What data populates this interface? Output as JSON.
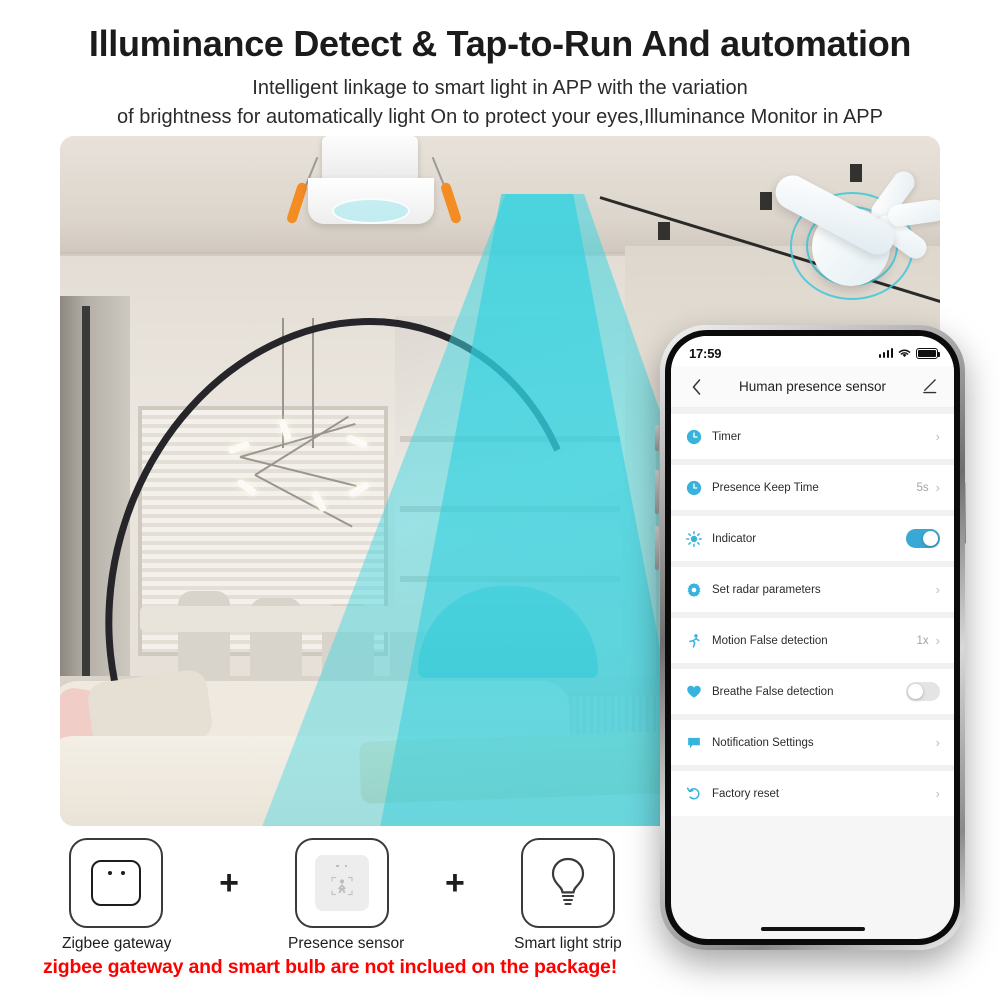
{
  "header": {
    "title": "Illuminance Detect & Tap-to-Run And automation",
    "subtitle_line1": "Intelligent linkage to smart light in APP with the variation",
    "subtitle_line2": "of brightness for automatically light On to protect your eyes,Illuminance Monitor in APP"
  },
  "phone": {
    "status": {
      "time": "17:59",
      "signal_icon": "cellular-signal-icon",
      "wifi_icon": "wifi-icon",
      "battery_icon": "battery-full-icon"
    },
    "nav": {
      "back_icon": "back-chevron-icon",
      "title": "Human presence sensor",
      "edit_icon": "edit-pencil-icon"
    },
    "rows": [
      {
        "icon": "clock-timer-icon",
        "label": "Timer",
        "value": "",
        "control": "chevron"
      },
      {
        "icon": "clock-icon",
        "label": "Presence Keep Time",
        "value": "5s",
        "control": "chevron"
      },
      {
        "icon": "brightness-sun-icon",
        "label": "Indicator",
        "value": "",
        "control": "toggle-on"
      },
      {
        "icon": "gear-icon",
        "label": "Set radar parameters",
        "value": "",
        "control": "chevron"
      },
      {
        "icon": "running-person-icon",
        "label": "Motion False detection",
        "value": "1x",
        "control": "chevron"
      },
      {
        "icon": "heart-icon",
        "label": "Breathe False detection",
        "value": "",
        "control": "toggle-off"
      },
      {
        "icon": "speech-bubble-icon",
        "label": "Notification Settings",
        "value": "",
        "control": "chevron"
      },
      {
        "icon": "undo-arrow-icon",
        "label": "Factory reset",
        "value": "",
        "control": "chevron"
      }
    ],
    "home_indicator": "home-indicator"
  },
  "products": {
    "items": [
      {
        "icon": "zigbee-gateway-icon",
        "caption": "Zigbee gateway"
      },
      {
        "icon": "presence-sensor-icon",
        "caption": "Presence sensor"
      },
      {
        "icon": "light-bulb-icon",
        "caption": "Smart light strip"
      }
    ],
    "separator": "+"
  },
  "disclaimer": "zigbee gateway and smart bulb are not inclued on the package!",
  "colors": {
    "accent_blue": "#3aa8d4",
    "detection_cone": "#3ad6e2",
    "clip_orange": "#f28c23",
    "disclaimer_red": "#ff0000"
  }
}
